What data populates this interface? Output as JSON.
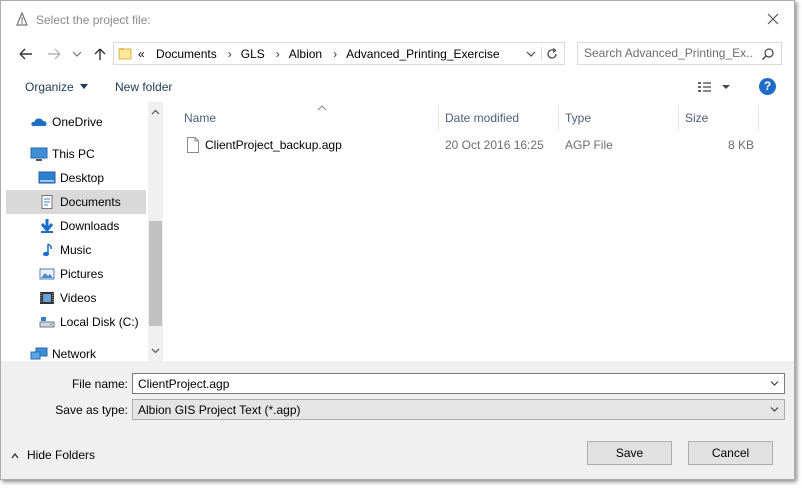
{
  "window": {
    "title": "Select the project file:"
  },
  "address": {
    "crumbs": [
      "«",
      "Documents",
      "GLS",
      "Albion",
      "Advanced_Printing_Exercise"
    ]
  },
  "search": {
    "placeholder": "Search Advanced_Printing_Ex..."
  },
  "toolbar": {
    "organize_label": "Organize",
    "new_folder_label": "New folder",
    "help_label": "?"
  },
  "sidebar": {
    "items": [
      {
        "label": "OneDrive",
        "icon": "onedrive-icon"
      },
      {
        "label": "This PC",
        "icon": "computer-icon"
      },
      {
        "label": "Desktop",
        "icon": "desktop-icon"
      },
      {
        "label": "Documents",
        "icon": "documents-icon"
      },
      {
        "label": "Downloads",
        "icon": "downloads-icon"
      },
      {
        "label": "Music",
        "icon": "music-icon"
      },
      {
        "label": "Pictures",
        "icon": "pictures-icon"
      },
      {
        "label": "Videos",
        "icon": "videos-icon"
      },
      {
        "label": "Local Disk (C:)",
        "icon": "disk-icon"
      },
      {
        "label": "Network",
        "icon": "network-icon"
      }
    ],
    "selected": "Documents"
  },
  "columns": {
    "name": "Name",
    "date": "Date modified",
    "type": "Type",
    "size": "Size"
  },
  "files": [
    {
      "name": "ClientProject_backup.agp",
      "date": "20 Oct 2016 16:25",
      "type": "AGP File",
      "size": "8 KB"
    }
  ],
  "form": {
    "file_name_label": "File name:",
    "file_name_value": "ClientProject.agp",
    "save_type_label": "Save as type:",
    "save_type_value": "Albion GIS Project Text (*.agp)"
  },
  "footer": {
    "hide_folders_label": "Hide Folders",
    "save_label": "Save",
    "cancel_label": "Cancel"
  },
  "colors": {
    "selected_bg": "#cce8ff",
    "footer_bg": "#f0f0f0",
    "header_text": "#4c607a",
    "link_text": "#1e395b"
  }
}
